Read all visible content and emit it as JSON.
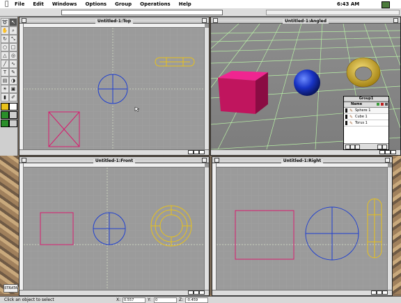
{
  "menubar": {
    "apple": "",
    "items": [
      "File",
      "Edit",
      "Windows",
      "Options",
      "Group",
      "Operations",
      "Help"
    ],
    "clock": "6:43 AM",
    "app_icon": "app-menu-icon"
  },
  "tools": [
    {
      "icon": "lasso-icon",
      "glyph": "➰"
    },
    {
      "icon": "arrow-icon",
      "glyph": "↖"
    },
    {
      "icon": "hand-icon",
      "glyph": "✋"
    },
    {
      "icon": "zoom-icon",
      "glyph": "⌕"
    },
    {
      "icon": "rotate-icon",
      "glyph": "↻"
    },
    {
      "icon": "scale-icon",
      "glyph": "⤡"
    },
    {
      "icon": "sphere-tool-icon",
      "glyph": "○"
    },
    {
      "icon": "box-tool-icon",
      "glyph": "□"
    },
    {
      "icon": "cone-tool-icon",
      "glyph": "△"
    },
    {
      "icon": "torus-tool-icon",
      "glyph": "◎"
    },
    {
      "icon": "line-tool-icon",
      "glyph": "╱"
    },
    {
      "icon": "curve-tool-icon",
      "glyph": "∿"
    },
    {
      "icon": "text-tool-icon",
      "glyph": "T"
    },
    {
      "icon": "pen-tool-icon",
      "glyph": "✎"
    },
    {
      "icon": "extrude-tool-icon",
      "glyph": "▤"
    },
    {
      "icon": "lathe-tool-icon",
      "glyph": "◑"
    },
    {
      "icon": "light-tool-icon",
      "glyph": "☀"
    },
    {
      "icon": "camera-tool-icon",
      "glyph": "▣"
    },
    {
      "icon": "paint-tool-icon",
      "glyph": "▮"
    },
    {
      "icon": "eyedropper-tool-icon",
      "glyph": "✐"
    }
  ],
  "colors": {
    "canvas": "#9b9b9b",
    "pink": "#d81b6e",
    "blue": "#1f3fd0",
    "yellow": "#e8c21a",
    "grid": "#c6c6c6",
    "axis": "#e5ecd8"
  },
  "windows": {
    "top": {
      "title": "Untitled-1:Top"
    },
    "angled": {
      "title": "Untitled-1:Angled"
    },
    "front": {
      "title": "Untitled-1:Front"
    },
    "right": {
      "title": "Untitled-1:Right"
    }
  },
  "group": {
    "title": "Group1",
    "header": "Name",
    "items": [
      "Sphere 1",
      "Cube 1",
      "Torus 1"
    ]
  },
  "status": {
    "message": "Click an object to select",
    "x_label": "X:",
    "x_value": "0.557",
    "y_label": "Y:",
    "y_value": "0",
    "z_label": "Z:",
    "z_value": "-0.459"
  },
  "badge": "STRATA"
}
